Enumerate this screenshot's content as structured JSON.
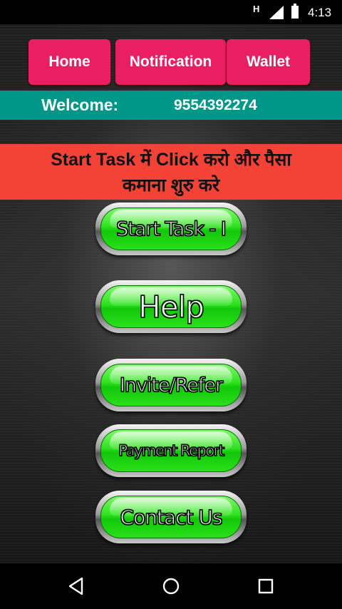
{
  "status_bar": {
    "network_type": "H",
    "time": "4:13",
    "icons": [
      "signal-icon",
      "battery-icon"
    ]
  },
  "top_nav": {
    "home_label": "Home",
    "notification_label": "Notification",
    "wallet_label": "Wallet",
    "button_color": "#e91e63"
  },
  "welcome": {
    "label": "Welcome:",
    "phone": "9554392274",
    "bar_color": "#009688"
  },
  "banner": {
    "line1": "Start Task में Click करो और पैसा",
    "line2": "कमाना शुरु करे",
    "color": "#f44336"
  },
  "menu": {
    "start_task": "Start Task - I",
    "help": "Help",
    "invite_refer": "Invite/Refer",
    "payment_report": "Payment Report",
    "contact_us": "Contact Us",
    "button_color": "#2ee11d"
  },
  "system_nav": {
    "icons": [
      "back-icon",
      "home-circle-icon",
      "recents-icon"
    ]
  }
}
